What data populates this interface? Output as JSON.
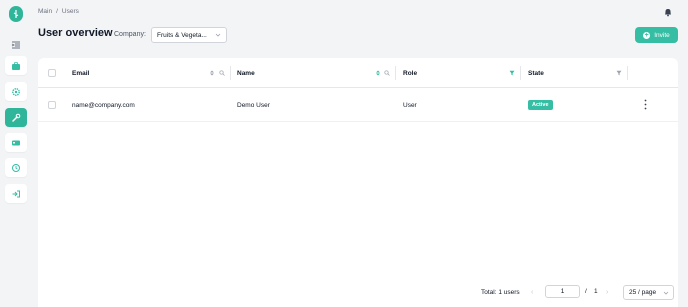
{
  "breadcrumb": {
    "root": "Main",
    "separator": "/",
    "current": "Users"
  },
  "header": {
    "title": "User overview",
    "company_label": "Company:",
    "company_value": "Fruits & Vegeta...",
    "invite_label": "Invite"
  },
  "sidebar": {
    "items": [
      {
        "icon": "collapse-icon"
      },
      {
        "icon": "briefcase-icon"
      },
      {
        "icon": "gear-icon"
      },
      {
        "icon": "wrench-icon",
        "active": true
      },
      {
        "icon": "card-icon"
      },
      {
        "icon": "clock-icon"
      },
      {
        "icon": "logout-icon"
      }
    ]
  },
  "table": {
    "columns": [
      "Email",
      "Name",
      "Role",
      "State"
    ],
    "rows": [
      {
        "email": "name@company.com",
        "name": "Demo User",
        "role": "User",
        "state": "Active"
      }
    ]
  },
  "pagination": {
    "total_label": "Total: 1 users",
    "current_page": "1",
    "separator": "/",
    "total_pages": "1",
    "page_size": "25 / page"
  },
  "colors": {
    "accent": "#36bea5",
    "background": "#f3f4f6"
  }
}
